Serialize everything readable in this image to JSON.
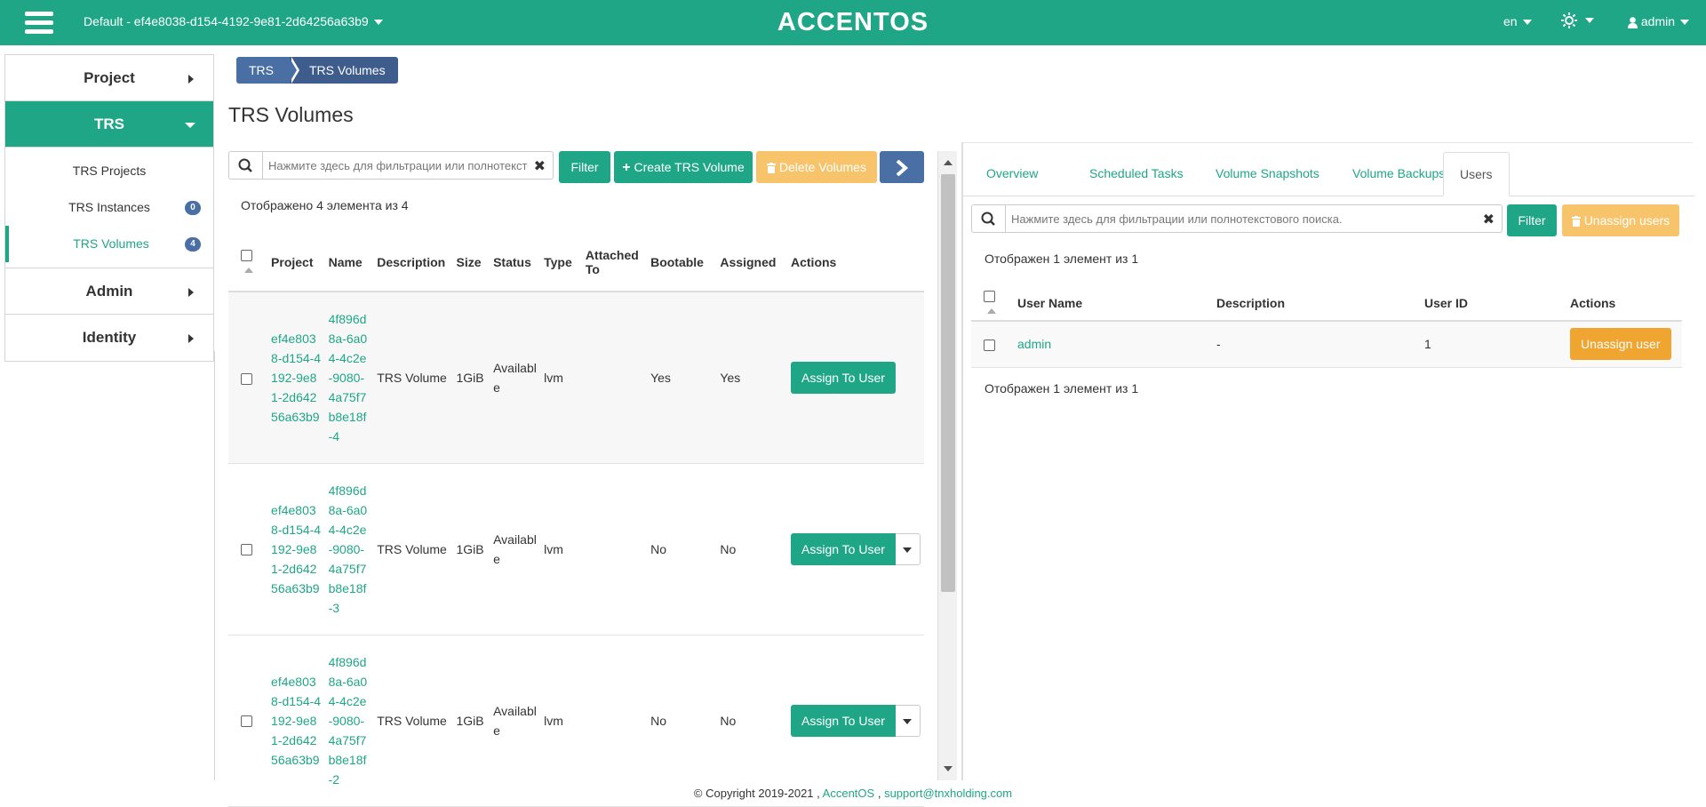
{
  "topbar": {
    "project": "Default - ef4e8038-d154-4192-9e81-2d64256a63b9",
    "logo": "ACCENTOS",
    "lang": "en",
    "user": "admin",
    "color": "#1fa687"
  },
  "sidebar": {
    "panels": [
      {
        "label": "Project"
      },
      {
        "label": "TRS"
      },
      {
        "label": "Admin"
      },
      {
        "label": "Identity"
      }
    ],
    "items": [
      {
        "label": "TRS Projects",
        "badge": ""
      },
      {
        "label": "TRS Instances",
        "badge": "0"
      },
      {
        "label": "TRS Volumes",
        "badge": "4"
      }
    ]
  },
  "breadcrumb": [
    "TRS",
    "TRS Volumes"
  ],
  "page_title": "TRS Volumes",
  "volumes": {
    "search_placeholder": "Нажмите здесь для фильтрации или полнотекстового поиска.",
    "filter_label": "Filter",
    "create_label": "Create TRS Volume",
    "delete_label": "Delete Volumes",
    "count_text": "Отображено 4 элемента из 4",
    "columns": [
      "Project",
      "Name",
      "Description",
      "Size",
      "Status",
      "Type",
      "Attached To",
      "Bootable",
      "Assigned",
      "Actions"
    ],
    "rows": [
      {
        "project": "ef4e8038-d154-4192-9e81-2d64256a63b9",
        "name": "4f896d8a-6a04-4c2e-9080-4a75f7b8e18f-4",
        "description": "TRS Volume",
        "size": "1GiB",
        "status": "Available",
        "type": "lvm",
        "attached": "",
        "bootable": "Yes",
        "assigned": "Yes",
        "action": "Assign To User"
      },
      {
        "project": "ef4e8038-d154-4192-9e81-2d64256a63b9",
        "name": "4f896d8a-6a04-4c2e-9080-4a75f7b8e18f-3",
        "description": "TRS Volume",
        "size": "1GiB",
        "status": "Available",
        "type": "lvm",
        "attached": "",
        "bootable": "No",
        "assigned": "No",
        "action": "Assign To User"
      },
      {
        "project": "ef4e8038-d154-4192-9e81-2d64256a63b9",
        "name": "4f896d8a-6a04-4c2e-9080-4a75f7b8e18f-2",
        "description": "TRS Volume",
        "size": "1GiB",
        "status": "Available",
        "type": "lvm",
        "attached": "",
        "bootable": "No",
        "assigned": "No",
        "action": "Assign To User"
      }
    ]
  },
  "details": {
    "tabs": [
      "Overview",
      "Scheduled Tasks",
      "Volume Snapshots",
      "Volume Backups",
      "Users"
    ],
    "active_tab": "Users",
    "search_placeholder": "Нажмите здесь для фильтрации или полнотекстового поиска.",
    "filter_label": "Filter",
    "unassign_users_label": "Unassign users",
    "count_text_top": "Отображен 1 элемент из 1",
    "count_text_bottom": "Отображен 1 элемент из 1",
    "columns": [
      "User Name",
      "Description",
      "User ID",
      "Actions"
    ],
    "rows": [
      {
        "user_name": "admin",
        "description": "-",
        "user_id": "1",
        "action": "Unassign user"
      }
    ]
  },
  "footer": {
    "copyright": "© Copyright 2019-2021 ,",
    "brand": "AccentOS",
    "separator": ",",
    "email": "support@tnxholding.com"
  }
}
